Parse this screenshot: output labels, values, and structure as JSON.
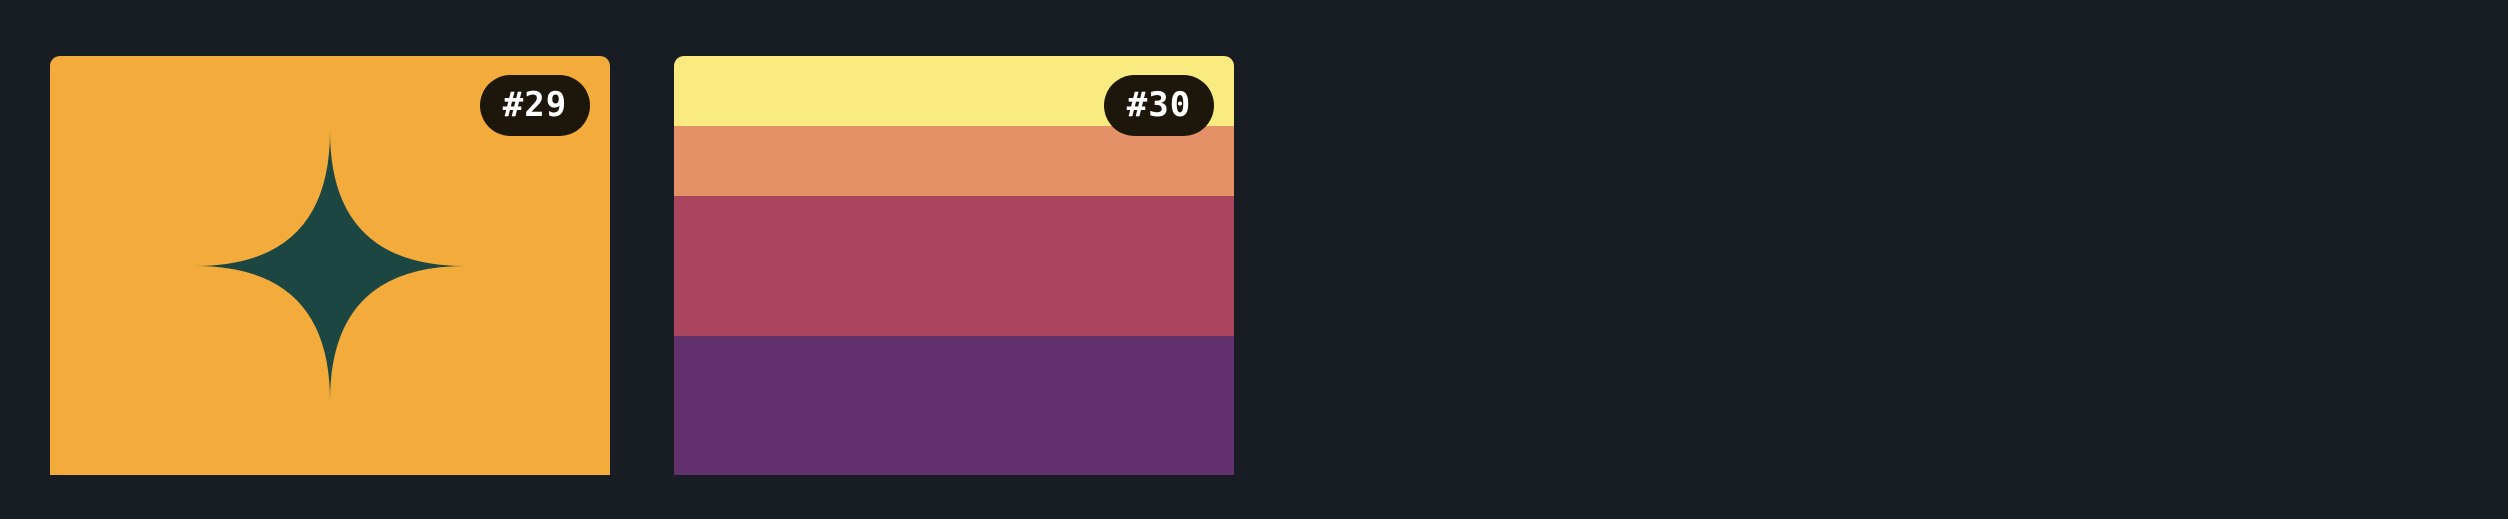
{
  "cards": [
    {
      "badge": "#29",
      "art": "four-point-sparkle",
      "colors": {
        "background": "#f3ac3c",
        "shape": "#1c4642"
      }
    },
    {
      "badge": "#30",
      "art": "horizontal-stripes",
      "colors": {
        "stripes": [
          "#f9eb7f",
          "#e59168",
          "#ab455f",
          "#62306c"
        ]
      }
    }
  ],
  "colors": {
    "page_background": "#181c23",
    "badge_background": "#1c160b",
    "badge_text": "#ffffff"
  }
}
